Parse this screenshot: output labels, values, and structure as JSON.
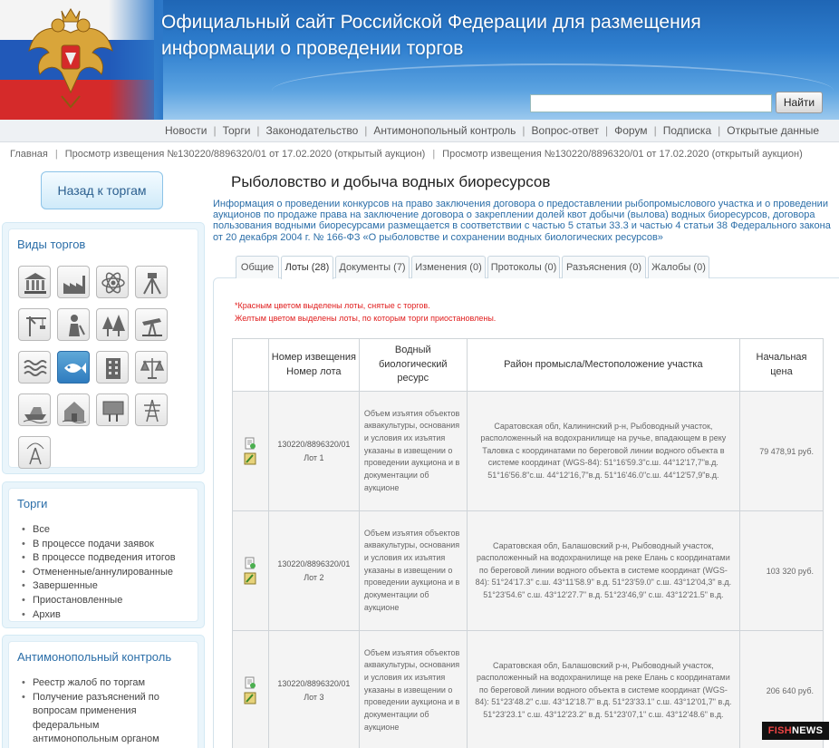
{
  "header": {
    "title_line1": "Официальный сайт Российской Федерации для размещения",
    "title_line2": "информации о проведении торгов",
    "search_value": "",
    "search_button": "Найти"
  },
  "topnav": [
    "Новости",
    "Торги",
    "Законодательство",
    "Антимонопольный контроль",
    "Вопрос-ответ",
    "Форум",
    "Подписка",
    "Открытые данные"
  ],
  "breadcrumb": [
    "Главная",
    "Просмотр извещения №130220/8896320/01 от 17.02.2020 (открытый аукцион)",
    "Просмотр извещения №130220/8896320/01 от 17.02.2020 (открытый аукцион)"
  ],
  "sidebar": {
    "back_label": "Назад к торгам",
    "types_title": "Виды торгов",
    "type_icons": [
      "bank-icon",
      "factory-icon",
      "atom-icon",
      "surveyor-icon",
      "crane-icon",
      "worker-icon",
      "forest-icon",
      "oil-pump-icon",
      "water-waves-icon",
      "fish-icon",
      "building-icon",
      "scales-icon",
      "boat-icon",
      "house-icon",
      "billboard-icon",
      "power-tower-icon",
      "antenna-icon"
    ],
    "torgi_title": "Торги",
    "torgi_items": [
      "Все",
      "В процессе подачи заявок",
      "В процессе подведения итогов",
      "Отмененные/аннулированные",
      "Завершенные",
      "Приостановленные",
      "Архив"
    ],
    "anti_title": "Антимонопольный контроль",
    "anti_items": [
      "Реестр жалоб по торгам",
      "Получение разъяснений по вопросам применения федеральным антимонопольным органом антимонопольного"
    ]
  },
  "main": {
    "title": "Рыболовство и добыча водных биоресурсов",
    "intro": "Информация о проведении конкурсов на право заключения договора о предоставлении рыбопромыслового участка и о проведении аукционов по продаже права на заключение договора о закреплении долей квот добычи (вылова) водных биоресурсов, договора пользования водными биоресурсами размещается в соответствии с частью 5 статьи 33.3 и частью 4 статьи 38 Федерального закона от 20 декабря 2004 г. № 166-ФЗ «О рыболовстве и сохранении водных биологических ресурсов»",
    "tabs": [
      "Общие",
      "Лоты (28)",
      "Документы (7)",
      "Изменения (0)",
      "Протоколы (0)",
      "Разъяснения (0)",
      "Жалобы (0)"
    ],
    "active_tab": "Лоты (28)",
    "note_red": "*Красным цветом выделены лоты, снятые с торгов.",
    "note_yellow": "Желтым цветом выделены лоты, по которым торги приостановлены.",
    "table_headers": {
      "num": "Номер извещения Номер лота",
      "resource": "Водный биологический ресурс",
      "area": "Район промысла/Местоположение участка",
      "price": "Начальная цена"
    },
    "rows": [
      {
        "notice": "130220/8896320/01",
        "lot": "Лот 1",
        "resource": "Объем изъятия объектов аквакультуры, основания и условия их изъятия указаны в извещении о проведении аукциона и в документации об аукционе",
        "area": "Саратовская обл, Калининский р-н, Рыбоводный участок, расположенный на водохранилище на ручье, впадающем в реку Таловка с координатами по береговой линии водного объекта в системе координат (WGS-84): 51°16'59.3\"с.ш. 44°12'17,7\"в.д. 51°16'56.8\"с.ш. 44°12'16,7\"в.д. 51°16'46.0\"с.ш. 44°12'57,9\"в.д.",
        "price": "79 478,91 руб."
      },
      {
        "notice": "130220/8896320/01",
        "lot": "Лот 2",
        "resource": "Объем изъятия объектов аквакультуры, основания и условия их изъятия указаны в извещении о проведении аукциона и в документации об аукционе",
        "area": "Саратовская обл, Балашовский р-н, Рыбоводный участок, расположенный на водохранилище на реке Елань с координатами по береговой линии водного объекта в системе координат (WGS-84): 51°24'17.3\" с.ш. 43°11'58.9\" в.д. 51°23'59.0\" с.ш. 43°12'04,3\" в.д. 51°23'54.6\" с.ш. 43°12'27.7\" в.д. 51°23'46,9\" с.ш. 43°12'21.5\" в.д.",
        "price": "103 320 руб."
      },
      {
        "notice": "130220/8896320/01",
        "lot": "Лот 3",
        "resource": "Объем изъятия объектов аквакультуры, основания и условия их изъятия указаны в извещении о проведении аукциона и в документации об аукционе",
        "area": "Саратовская обл, Балашовский р-н, Рыбоводный участок, расположенный на водохранилище на реке Елань с координатами по береговой линии водного объекта в системе координат (WGS-84): 51°23'48.2\" с.ш. 43°12'18.7\" в.д. 51°23'33.1\" с.ш. 43°12'01,7\" в.д. 51°23'23.1\" с.ш. 43°12'23.2\" в.д. 51°23'07,1\" с.ш. 43°12'48.6\" в.д.",
        "price": "206 640 руб."
      }
    ]
  },
  "watermark": {
    "part1": "FISH",
    "part2": "NEWS"
  }
}
